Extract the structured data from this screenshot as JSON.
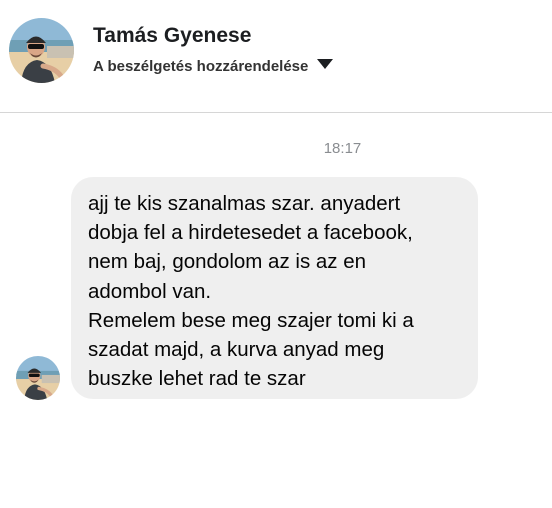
{
  "header": {
    "contact_name": "Tamás Gyenese",
    "assign_label": "A beszélgetés hozzárendelése",
    "avatar_icon": "profile-photo",
    "dropdown_icon": "caret-down-icon"
  },
  "conversation": {
    "timestamp": "18:17",
    "messages": [
      {
        "sender": "Tamás Gyenese",
        "text": "ajj te kis szanalmas szar. anyadert\ndobja fel a hirdetesedet a facebook,\nnem baj, gondolom az is az en\nadombol van.\nRemelem bese meg szajer tomi ki a\nszadat majd, a kurva anyad meg\nbuszke lehet rad te szar"
      }
    ]
  },
  "colors": {
    "bubble_background": "#efefef",
    "timestamp_text": "#8a8d91",
    "divider": "#d6d6d6"
  }
}
